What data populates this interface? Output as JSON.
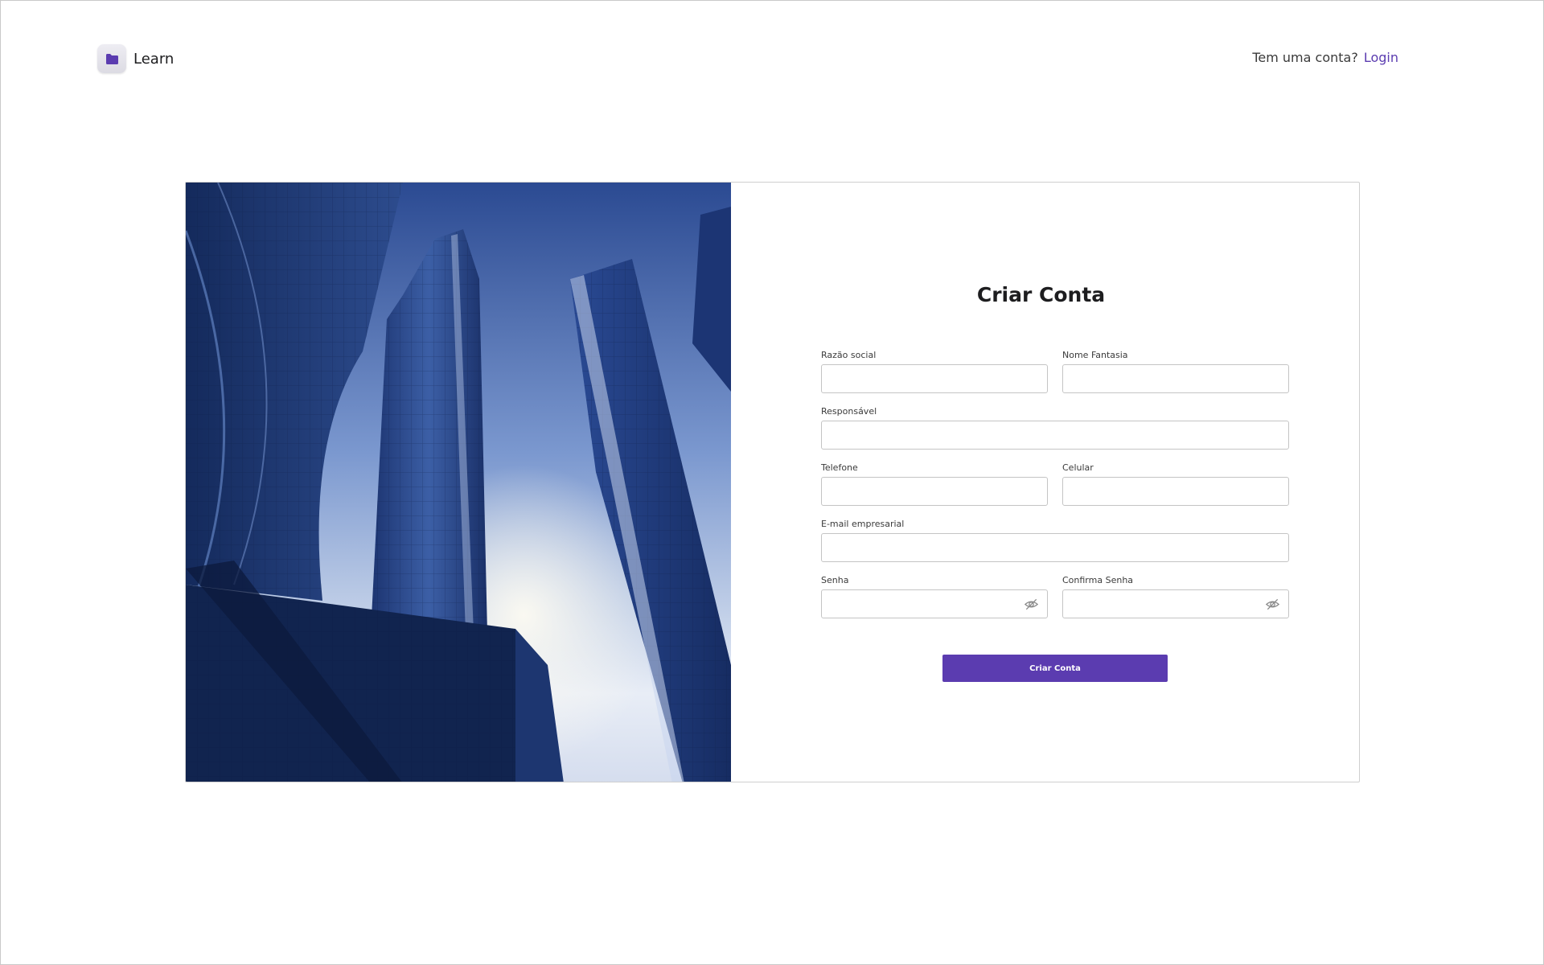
{
  "header": {
    "brand_name": "Learn",
    "brand_icon": "folder-icon",
    "account_question": "Tem uma conta?",
    "login_label": "Login"
  },
  "signup": {
    "image_icon": "skyscrapers-photo",
    "title": "Criar Conta",
    "fields": {
      "razao_social": {
        "label": "Razão social",
        "value": ""
      },
      "nome_fantasia": {
        "label": "Nome Fantasia",
        "value": ""
      },
      "responsavel": {
        "label": "Responsável",
        "value": ""
      },
      "telefone": {
        "label": "Telefone",
        "value": ""
      },
      "celular": {
        "label": "Celular",
        "value": ""
      },
      "email": {
        "label": "E-mail empresarial",
        "value": ""
      },
      "senha": {
        "label": "Senha",
        "value": "",
        "toggle_icon": "eye-off-icon"
      },
      "confirma_senha": {
        "label": "Confirma Senha",
        "value": "",
        "toggle_icon": "eye-off-icon"
      }
    },
    "submit_label": "Criar Conta"
  },
  "colors": {
    "accent": "#5b3cb0",
    "border": "#c4c4c4",
    "text": "#1d1d1f"
  }
}
